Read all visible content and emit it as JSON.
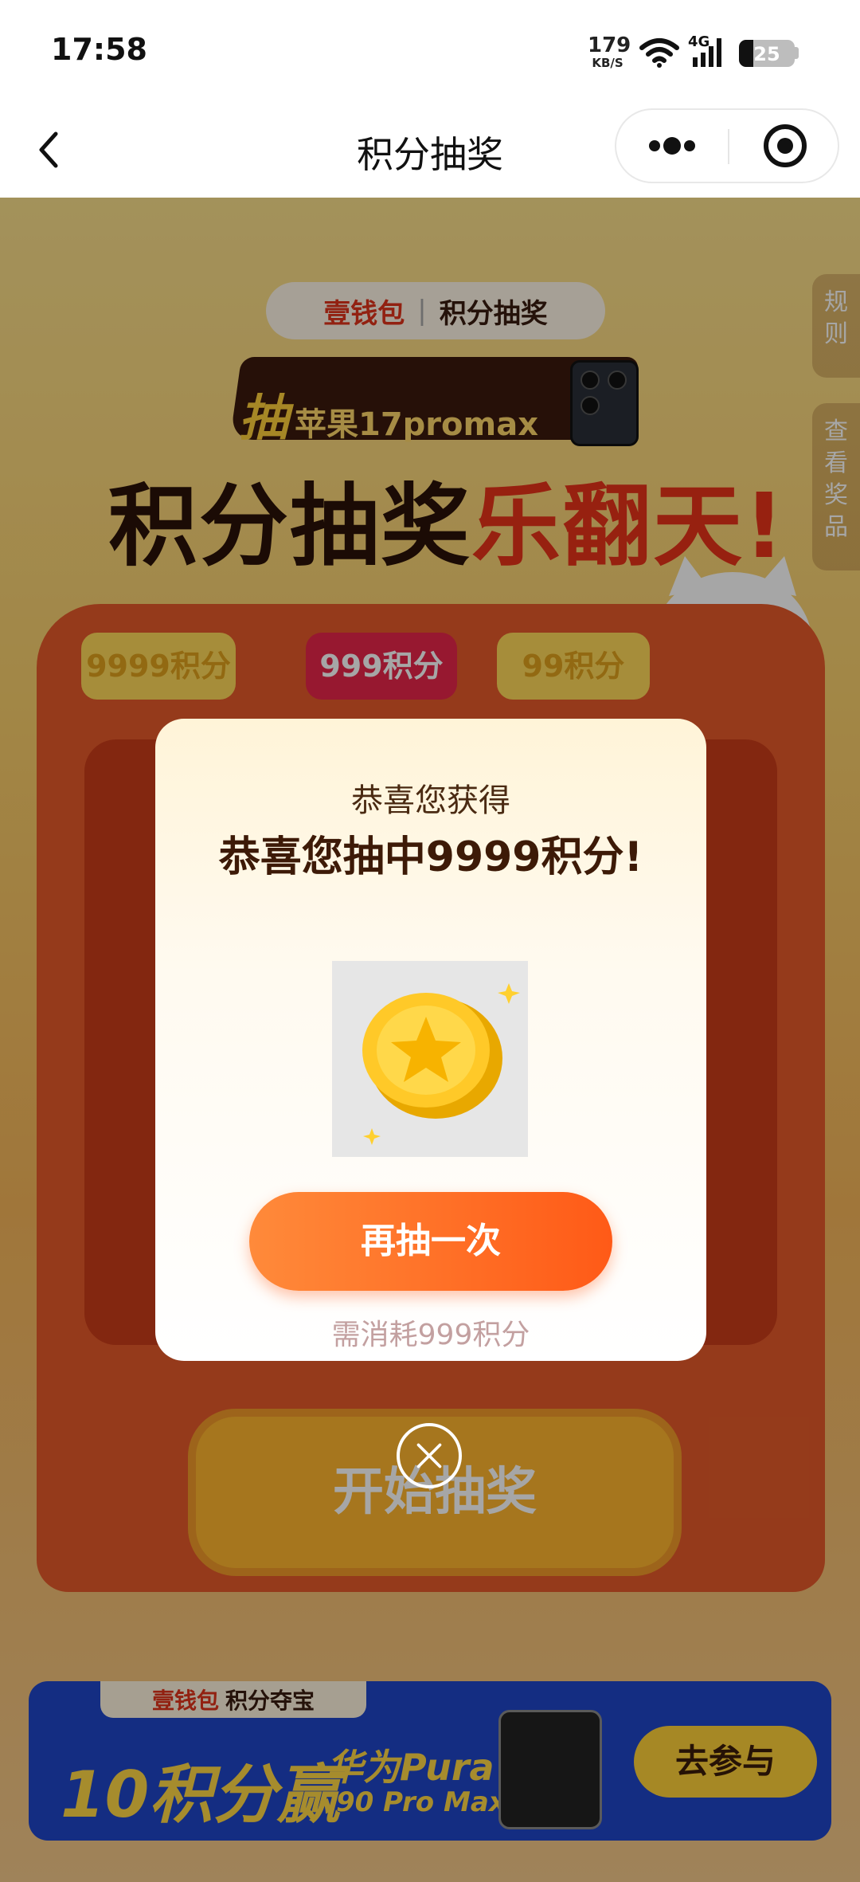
{
  "status_bar": {
    "time": "17:58",
    "net_speed_value": "179",
    "net_speed_unit": "KB/S",
    "network_type": "4G",
    "battery_level": "25"
  },
  "nav": {
    "title": "积分抽奖",
    "back_icon": "chevron-left-icon",
    "more_icon": "more-dots-icon",
    "close_icon": "target-circle-icon"
  },
  "background": {
    "brand_left": "壹钱包",
    "brand_sep": "|",
    "brand_right": "积分抽奖",
    "promo_prefix": "抽",
    "promo_text": "苹果17promax",
    "headline_left": "积分抽奖",
    "headline_right": "乐翻天!",
    "side_tab_rules": "规则",
    "side_tab_prizes": "查看奖品",
    "chips": [
      "9999积分",
      "999积分",
      "99积分"
    ],
    "start_button": "开始抽奖",
    "bottom_banner": {
      "brand_left": "壹钱包",
      "brand_right": "积分夺宝",
      "main": "10积分赢",
      "sub1": "华为Pura",
      "sub2": "90 Pro Max",
      "button": "去参与"
    }
  },
  "dialog": {
    "subtitle": "恭喜您获得",
    "title": "恭喜您抽中9999积分!",
    "prize_icon": "gold-star-coin-icon",
    "again_button": "再抽一次",
    "cost_note": "需消耗999积分",
    "close_icon": "close-x-circle-icon"
  },
  "colors": {
    "accent_orange": "#ff5a17",
    "dialog_title": "#3d1a07",
    "cost_note": "#c3a0a0"
  }
}
